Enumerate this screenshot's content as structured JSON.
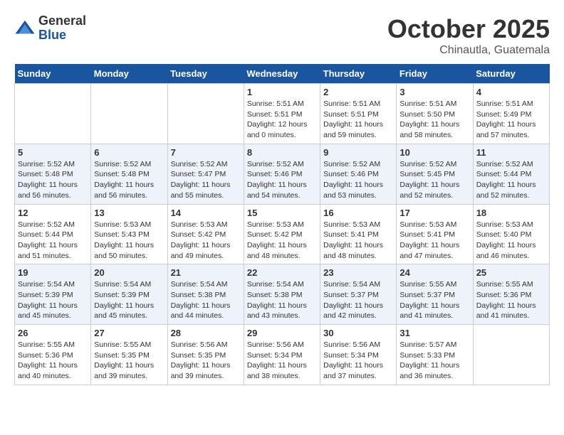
{
  "header": {
    "logo_general": "General",
    "logo_blue": "Blue",
    "month_title": "October 2025",
    "location": "Chinautla, Guatemala"
  },
  "days_of_week": [
    "Sunday",
    "Monday",
    "Tuesday",
    "Wednesday",
    "Thursday",
    "Friday",
    "Saturday"
  ],
  "weeks": [
    [
      {
        "day": "",
        "info": ""
      },
      {
        "day": "",
        "info": ""
      },
      {
        "day": "",
        "info": ""
      },
      {
        "day": "1",
        "info": "Sunrise: 5:51 AM\nSunset: 5:51 PM\nDaylight: 12 hours\nand 0 minutes."
      },
      {
        "day": "2",
        "info": "Sunrise: 5:51 AM\nSunset: 5:51 PM\nDaylight: 11 hours\nand 59 minutes."
      },
      {
        "day": "3",
        "info": "Sunrise: 5:51 AM\nSunset: 5:50 PM\nDaylight: 11 hours\nand 58 minutes."
      },
      {
        "day": "4",
        "info": "Sunrise: 5:51 AM\nSunset: 5:49 PM\nDaylight: 11 hours\nand 57 minutes."
      }
    ],
    [
      {
        "day": "5",
        "info": "Sunrise: 5:52 AM\nSunset: 5:48 PM\nDaylight: 11 hours\nand 56 minutes."
      },
      {
        "day": "6",
        "info": "Sunrise: 5:52 AM\nSunset: 5:48 PM\nDaylight: 11 hours\nand 56 minutes."
      },
      {
        "day": "7",
        "info": "Sunrise: 5:52 AM\nSunset: 5:47 PM\nDaylight: 11 hours\nand 55 minutes."
      },
      {
        "day": "8",
        "info": "Sunrise: 5:52 AM\nSunset: 5:46 PM\nDaylight: 11 hours\nand 54 minutes."
      },
      {
        "day": "9",
        "info": "Sunrise: 5:52 AM\nSunset: 5:46 PM\nDaylight: 11 hours\nand 53 minutes."
      },
      {
        "day": "10",
        "info": "Sunrise: 5:52 AM\nSunset: 5:45 PM\nDaylight: 11 hours\nand 52 minutes."
      },
      {
        "day": "11",
        "info": "Sunrise: 5:52 AM\nSunset: 5:44 PM\nDaylight: 11 hours\nand 52 minutes."
      }
    ],
    [
      {
        "day": "12",
        "info": "Sunrise: 5:52 AM\nSunset: 5:44 PM\nDaylight: 11 hours\nand 51 minutes."
      },
      {
        "day": "13",
        "info": "Sunrise: 5:53 AM\nSunset: 5:43 PM\nDaylight: 11 hours\nand 50 minutes."
      },
      {
        "day": "14",
        "info": "Sunrise: 5:53 AM\nSunset: 5:42 PM\nDaylight: 11 hours\nand 49 minutes."
      },
      {
        "day": "15",
        "info": "Sunrise: 5:53 AM\nSunset: 5:42 PM\nDaylight: 11 hours\nand 48 minutes."
      },
      {
        "day": "16",
        "info": "Sunrise: 5:53 AM\nSunset: 5:41 PM\nDaylight: 11 hours\nand 48 minutes."
      },
      {
        "day": "17",
        "info": "Sunrise: 5:53 AM\nSunset: 5:41 PM\nDaylight: 11 hours\nand 47 minutes."
      },
      {
        "day": "18",
        "info": "Sunrise: 5:53 AM\nSunset: 5:40 PM\nDaylight: 11 hours\nand 46 minutes."
      }
    ],
    [
      {
        "day": "19",
        "info": "Sunrise: 5:54 AM\nSunset: 5:39 PM\nDaylight: 11 hours\nand 45 minutes."
      },
      {
        "day": "20",
        "info": "Sunrise: 5:54 AM\nSunset: 5:39 PM\nDaylight: 11 hours\nand 45 minutes."
      },
      {
        "day": "21",
        "info": "Sunrise: 5:54 AM\nSunset: 5:38 PM\nDaylight: 11 hours\nand 44 minutes."
      },
      {
        "day": "22",
        "info": "Sunrise: 5:54 AM\nSunset: 5:38 PM\nDaylight: 11 hours\nand 43 minutes."
      },
      {
        "day": "23",
        "info": "Sunrise: 5:54 AM\nSunset: 5:37 PM\nDaylight: 11 hours\nand 42 minutes."
      },
      {
        "day": "24",
        "info": "Sunrise: 5:55 AM\nSunset: 5:37 PM\nDaylight: 11 hours\nand 41 minutes."
      },
      {
        "day": "25",
        "info": "Sunrise: 5:55 AM\nSunset: 5:36 PM\nDaylight: 11 hours\nand 41 minutes."
      }
    ],
    [
      {
        "day": "26",
        "info": "Sunrise: 5:55 AM\nSunset: 5:36 PM\nDaylight: 11 hours\nand 40 minutes."
      },
      {
        "day": "27",
        "info": "Sunrise: 5:55 AM\nSunset: 5:35 PM\nDaylight: 11 hours\nand 39 minutes."
      },
      {
        "day": "28",
        "info": "Sunrise: 5:56 AM\nSunset: 5:35 PM\nDaylight: 11 hours\nand 39 minutes."
      },
      {
        "day": "29",
        "info": "Sunrise: 5:56 AM\nSunset: 5:34 PM\nDaylight: 11 hours\nand 38 minutes."
      },
      {
        "day": "30",
        "info": "Sunrise: 5:56 AM\nSunset: 5:34 PM\nDaylight: 11 hours\nand 37 minutes."
      },
      {
        "day": "31",
        "info": "Sunrise: 5:57 AM\nSunset: 5:33 PM\nDaylight: 11 hours\nand 36 minutes."
      },
      {
        "day": "",
        "info": ""
      }
    ]
  ]
}
